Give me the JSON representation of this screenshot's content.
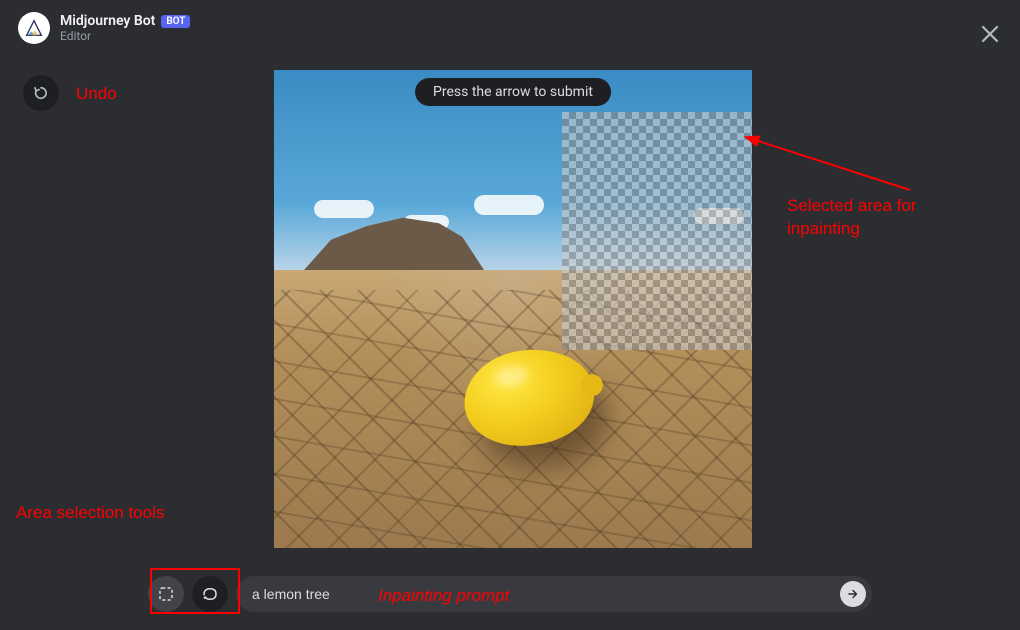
{
  "header": {
    "bot_name": "Midjourney Bot",
    "bot_badge": "BOT",
    "subtitle": "Editor"
  },
  "tooltip": {
    "text": "Press the arrow to submit"
  },
  "prompt": {
    "value": "a lemon tree"
  },
  "annotations": {
    "undo": "Undo",
    "area_tools": "Area selection tools",
    "inpaint_prompt": "Inpainting prompt",
    "selected_area": "Selected area for\ninpainting"
  },
  "icons": {
    "undo": "undo-icon",
    "close": "close-icon",
    "rect_select": "rectangle-select-icon",
    "lasso": "lasso-icon",
    "submit": "arrow-right-icon"
  }
}
